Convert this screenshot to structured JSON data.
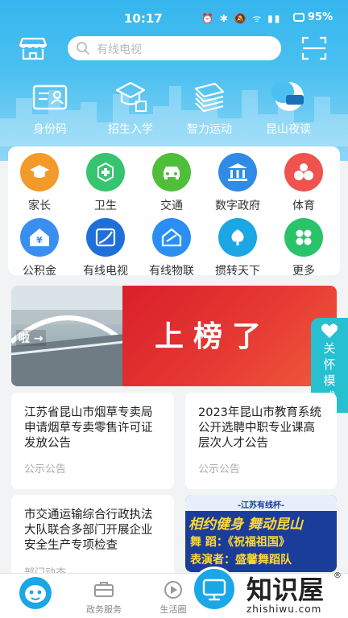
{
  "status_bar": {
    "time": "10:17",
    "battery": "95%"
  },
  "search": {
    "placeholder": "有线电视"
  },
  "quick_links": [
    {
      "label": "身份码",
      "icon": "id-card-icon"
    },
    {
      "label": "招生入学",
      "icon": "graduation-cap-icon"
    },
    {
      "label": "智力运动",
      "icon": "books-icon"
    },
    {
      "label": "昆山夜读",
      "icon": "night-reading-icon",
      "badge": "夜读"
    }
  ],
  "services": [
    {
      "label": "家长",
      "icon": "graduation-cap-icon",
      "color": "#f39a2b"
    },
    {
      "label": "卫生",
      "icon": "health-cross-icon",
      "color": "#36c46e"
    },
    {
      "label": "交通",
      "icon": "car-icon",
      "color": "#4fbf3a"
    },
    {
      "label": "数字政府",
      "icon": "government-building-icon",
      "color": "#2f8be6"
    },
    {
      "label": "体育",
      "icon": "sports-icon",
      "color": "#f0524d"
    },
    {
      "label": "公积金",
      "icon": "housing-fund-icon",
      "color": "#3a8ef0"
    },
    {
      "label": "有线电视",
      "icon": "cable-tv-icon",
      "color": "#1e6fd8"
    },
    {
      "label": "有线物联",
      "icon": "iot-house-icon",
      "color": "#2b8ef3"
    },
    {
      "label": "掼转天下",
      "icon": "cards-icon",
      "color": "#1ba6e6"
    },
    {
      "label": "更多",
      "icon": "more-grid-icon",
      "color": "#29c36a"
    }
  ],
  "banner": {
    "title": "上榜了",
    "left_caption": "啦 →"
  },
  "care_mode": {
    "label": "关怀模式"
  },
  "news": [
    {
      "title": "江苏省昆山市烟草专卖局申请烟草专卖零售许可证发放公告",
      "category": "公示公告"
    },
    {
      "title": "2023年昆山市教育系统公开选聘中职专业课高层次人才公告",
      "category": "公示公告"
    },
    {
      "title": "市交通运输综合行政执法大队联合多部门开展企业安全生产专项检查",
      "category": "部门动态"
    }
  ],
  "event_card": {
    "header": "-江苏有线杯-",
    "line1": "相约健身 舞动昆山",
    "line2": "舞 蹈：《祝福祖国》",
    "line3": "表演者：盛馨舞蹈队"
  },
  "tabbar": [
    {
      "label": "政务服务",
      "icon": "briefcase-icon"
    },
    {
      "label": "生活圈",
      "icon": "play-circle-icon"
    }
  ],
  "watermark": {
    "text": "知识屋",
    "reg": "®",
    "url": "zhishiwu.com"
  }
}
